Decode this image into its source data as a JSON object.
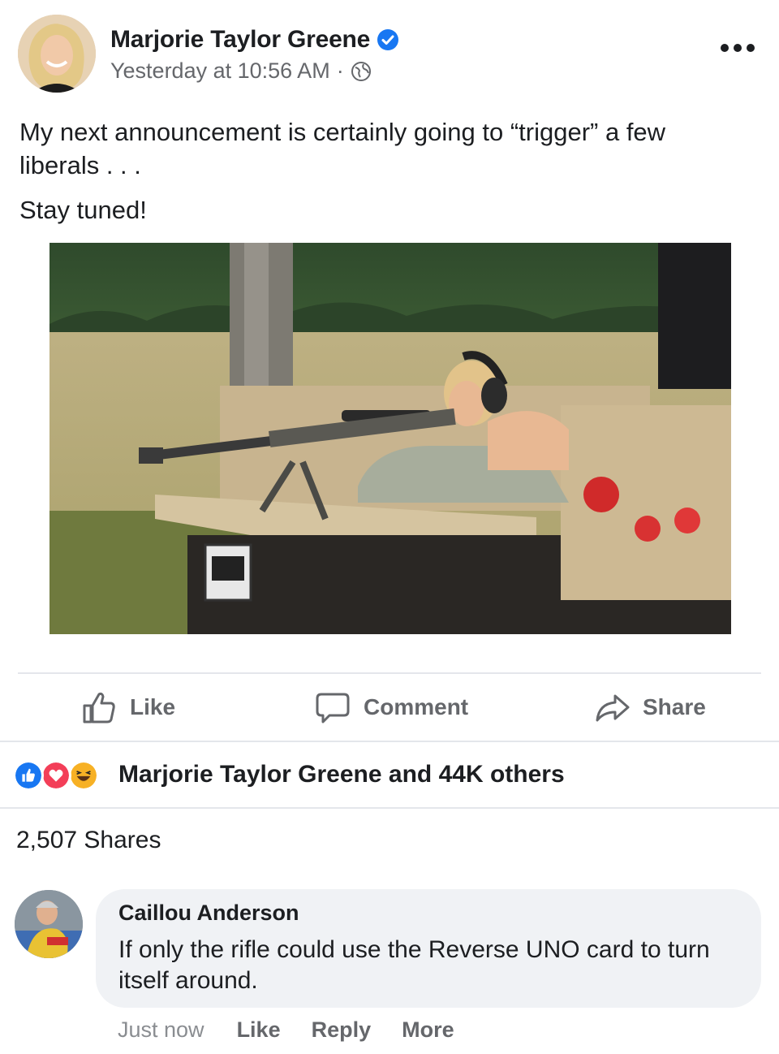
{
  "post": {
    "author": "Marjorie Taylor Greene",
    "timestamp": "Yesterday at 10:56 AM",
    "separator": "·",
    "privacy_icon": "globe-icon",
    "verified_icon": "verified-badge-icon",
    "text_line1": "My next announcement is certainly going to “trigger” a few liberals . . .",
    "text_line2": "Stay tuned!",
    "photo_caption": "",
    "more_icon": "more-dots-icon"
  },
  "actions": {
    "like_label": "Like",
    "comment_label": "Comment",
    "share_label": "Share"
  },
  "reactions": {
    "icons": [
      "like-reaction-icon",
      "love-reaction-icon",
      "haha-reaction-icon"
    ],
    "summary": "Marjorie Taylor Greene and 44K others"
  },
  "shares_count": "2,507 Shares",
  "comment": {
    "author": "Caillou Anderson",
    "text": "If only the rifle could use the Reverse UNO card to turn itself around.",
    "time": "Just now",
    "like_label": "Like",
    "reply_label": "Reply",
    "more_label": "More"
  },
  "colors": {
    "brand_blue": "#1877f2",
    "love_red": "#f33e58",
    "haha_yellow": "#f7b125",
    "secondary_text": "#65676b",
    "bubble_bg": "#f0f2f5"
  }
}
